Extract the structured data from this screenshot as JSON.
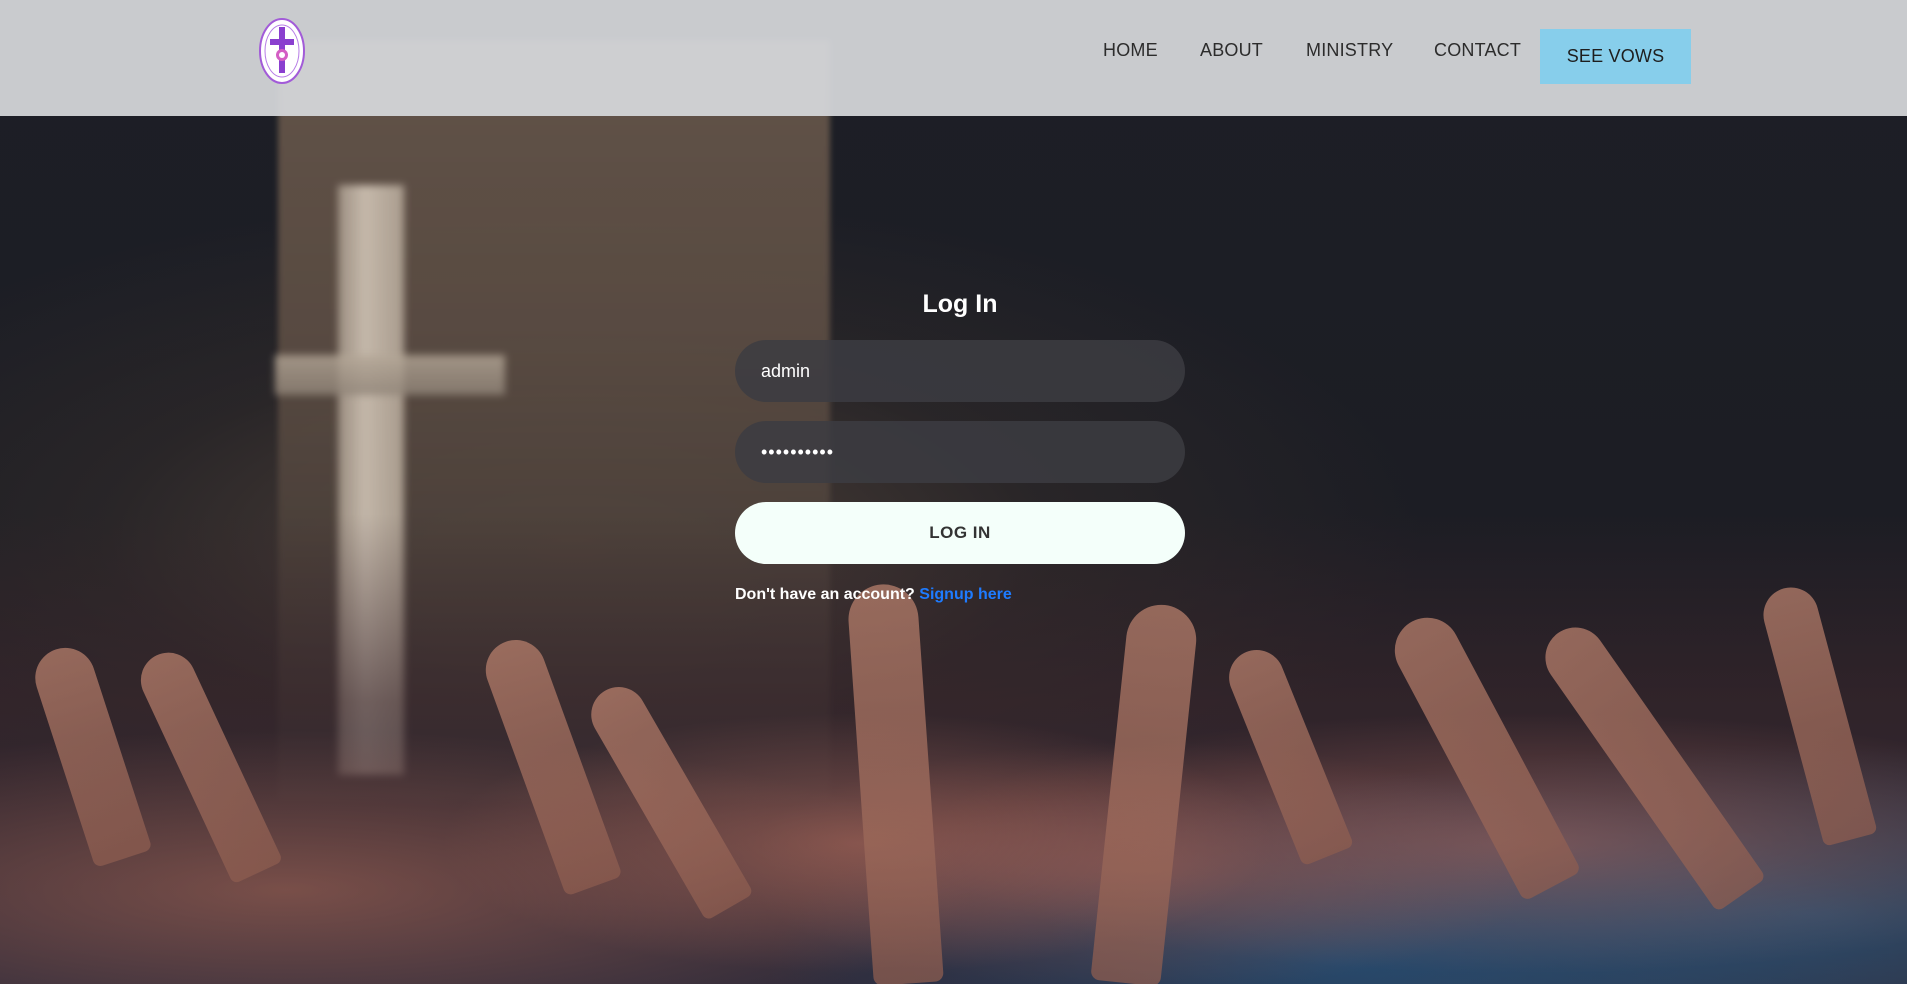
{
  "header": {
    "logo_icon": "church-seal-logo",
    "nav": [
      {
        "label": "HOME"
      },
      {
        "label": "ABOUT"
      },
      {
        "label": "MINISTRY"
      },
      {
        "label": "CONTACT"
      }
    ],
    "cta_label": "SEE VOWS",
    "cta_color": "#87ceeb"
  },
  "login": {
    "title": "Log In",
    "username_value": "admin",
    "password_value": "••••••••••",
    "submit_label": "LOG IN",
    "signup_prompt": "Don't have an account?",
    "signup_link": "Signup here",
    "link_color": "#1e7bff"
  },
  "background": {
    "scene": "worship-crowd-with-cross"
  }
}
